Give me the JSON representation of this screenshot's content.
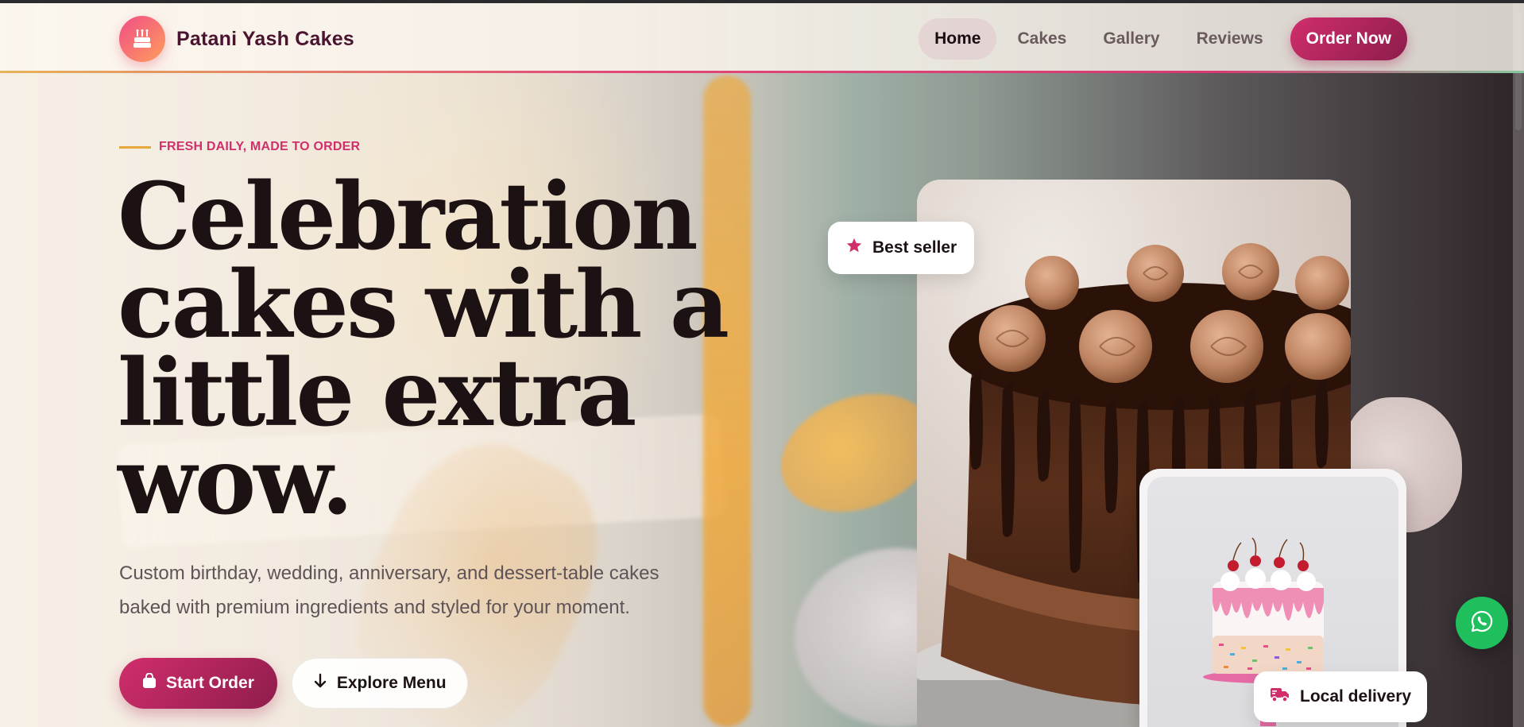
{
  "brand": {
    "name": "Patani Yash Cakes",
    "logo_icon": "cake-icon"
  },
  "nav": {
    "links": [
      {
        "label": "Home",
        "active": true
      },
      {
        "label": "Cakes",
        "active": false
      },
      {
        "label": "Gallery",
        "active": false
      },
      {
        "label": "Reviews",
        "active": false
      }
    ],
    "order_button": "Order Now"
  },
  "hero": {
    "eyebrow": "FRESH DAILY, MADE TO ORDER",
    "headline": "Celebration cakes with a little extra wow.",
    "subtext": "Custom birthday, wedding, anniversary, and dessert-table cakes baked with premium ingredients and styled for your moment.",
    "primary_cta": "Start Order",
    "primary_cta_icon": "shopping-bag-icon",
    "secondary_cta": "Explore Menu",
    "secondary_cta_icon": "arrow-down-icon"
  },
  "badges": {
    "best_seller": "Best seller",
    "best_seller_icon": "star-icon",
    "delivery": "Local delivery",
    "delivery_icon": "truck-icon"
  },
  "floating": {
    "whatsapp_icon": "whatsapp-icon"
  },
  "colors": {
    "accent": "#d12e6c",
    "accent_dark": "#8c1d4b",
    "eyebrow_line": "#e4a93a",
    "whatsapp": "#1fbf5d",
    "brand_text": "#4a1430"
  }
}
